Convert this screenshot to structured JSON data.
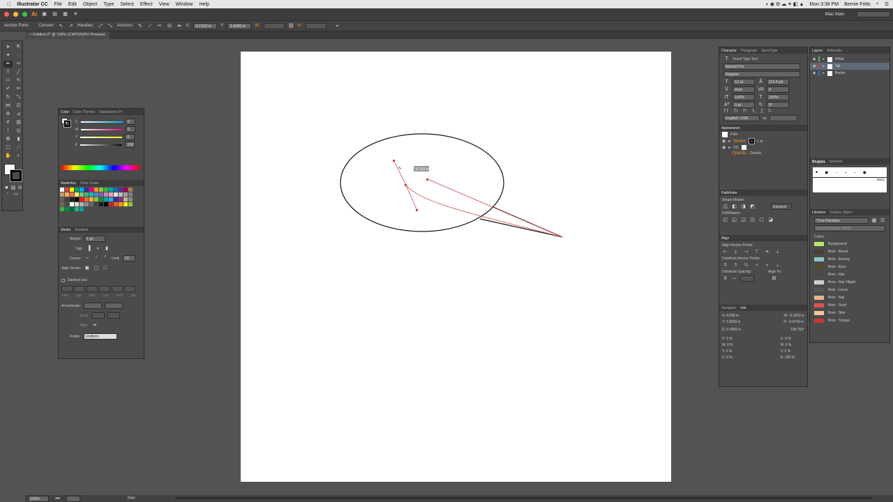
{
  "menubar": {
    "app": "Illustrator CC",
    "items": [
      "File",
      "Edit",
      "Object",
      "Type",
      "Select",
      "Effect",
      "View",
      "Window",
      "Help"
    ],
    "clock": "Mon 3:38 PM",
    "user": "Bernie Fritts"
  },
  "appbar": {
    "logo": "Ai",
    "workspace": "iMac Main"
  },
  "control": {
    "tool": "Anchor Point",
    "convert": "Convert:",
    "handles": "Handles:",
    "anchors": "Anchors:",
    "x_label": "X:",
    "x_value": "4.2163 in",
    "y_label": "Y:",
    "y_value": "3.4286 in",
    "w_label": "W:",
    "h_label": "H:"
  },
  "doc_tab": "Untitled-2* @ 156% (CMYK/GPU Preview)",
  "tooltip": "D: 0.6 in",
  "status": {
    "zoom": "156%",
    "mode": "Pen"
  },
  "color_panel": {
    "tabs": [
      "Color",
      "Color Themes",
      "Separations Pr"
    ],
    "channels": [
      {
        "l": "C",
        "v": "0"
      },
      {
        "l": "M",
        "v": "0"
      },
      {
        "l": "Y",
        "v": "0"
      },
      {
        "l": "K",
        "v": "100"
      }
    ]
  },
  "swatches_panel": {
    "tabs": [
      "Swatches",
      "Color Guide"
    ]
  },
  "stroke_panel": {
    "tabs": [
      "Stroke",
      "Gradient"
    ],
    "weight_label": "Weight:",
    "weight": "1 pt",
    "cap_label": "Cap:",
    "corner_label": "Corner:",
    "limit_label": "Limit:",
    "limit": "10",
    "align_label": "Align Stroke:",
    "dashed": "Dashed Line",
    "dash_labels": [
      "dash",
      "gap",
      "dash",
      "gap",
      "dash",
      "gap"
    ],
    "arrowheads": "Arrowheads:",
    "scale": "Scale:",
    "align2": "Align:",
    "profile_label": "Profile:",
    "profile": "Uniform"
  },
  "char_panel": {
    "tabs": [
      "Character",
      "Paragraph",
      "OpenType"
    ],
    "touch": "Touch Type Tool",
    "font": "Myriad Pro",
    "style": "Regular",
    "size": "12 pt",
    "leading": "(14.4 pt)",
    "kerning": "Auto",
    "tracking": "0",
    "hscale": "100%",
    "vscale": "100%",
    "baseline": "0 pt",
    "rotate": "0°",
    "lang": "English: USA",
    "aa": "aa"
  },
  "appearance_panel": {
    "title": "Appearance",
    "path": "Path",
    "stroke_label": "Stroke:",
    "stroke_value": "1 pt",
    "fill_label": "Fill:",
    "opacity_label": "Opacity:",
    "opacity_value": "Default"
  },
  "pathfinder_panel": {
    "title": "Pathfinder",
    "shape_modes": "Shape Modes:",
    "expand": "Expand",
    "pathfinders": "Pathfinders:"
  },
  "align_panel": {
    "title": "Align",
    "anchor": "Align Anchor Points:",
    "distribute": "Distribute Anchor Points:",
    "spacing": "Distribute Spacing:",
    "align_to": "Align To:"
  },
  "info_panel": {
    "tabs": [
      "Navigator",
      "Info"
    ],
    "x": "X: 4.058 in",
    "y": "Y: 2.9569 in",
    "w": "W: -0.1603 in",
    "h": "H: -0.4719 in",
    "d": "D: 0.4983 in",
    "angle": "108.759°",
    "cmyk_left": [
      "C: 0 %",
      "M: 0 %",
      "Y: 0 %",
      "K: 0 %"
    ],
    "cmyk_right": [
      "C: 0 %",
      "M: 0 %",
      "Y: 0 %",
      "K: 100 %"
    ]
  },
  "layers_panel": {
    "tabs": [
      "Layers",
      "Artboards"
    ],
    "layers": [
      {
        "name": "White",
        "color": "#4fb54f"
      },
      {
        "name": "Tail",
        "color": "#d23b3b"
      },
      {
        "name": "Border",
        "color": "#3b6fd2"
      }
    ],
    "count": "3 Layers"
  },
  "brushes_panel": {
    "tabs": [
      "Brushes",
      "Symbols"
    ],
    "basic": "Basic"
  },
  "libraries_panel": {
    "tabs": [
      "Libraries",
      "Graphic Styles"
    ],
    "library": "Time Paradox",
    "search": "Search Adobe Stock",
    "section": "Colors",
    "colors": [
      {
        "name": "Background",
        "hex": "#b8e86a"
      },
      {
        "name": "Brek - Beard",
        "hex": "#4a4032"
      },
      {
        "name": "Brek - Earring",
        "hex": "#8fc8c8"
      },
      {
        "name": "Brek - Eyes",
        "hex": "#5a4a2c"
      },
      {
        "name": "Brek - Hair",
        "hex": "#4a4a4a"
      },
      {
        "name": "Brek - Hair Hilight",
        "hex": "#cfcfcf"
      },
      {
        "name": "Brek - Laces",
        "hex": "#555555"
      },
      {
        "name": "Brek - Nail",
        "hex": "#e8b68a"
      },
      {
        "name": "Brek - Scarf",
        "hex": "#e05050"
      },
      {
        "name": "Brek - Skin",
        "hex": "#f0c6a0"
      },
      {
        "name": "Brek - Tongue",
        "hex": "#c83838"
      }
    ]
  }
}
